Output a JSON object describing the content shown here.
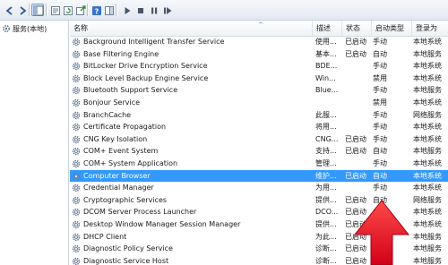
{
  "tree": {
    "root_label": "服务(本地)"
  },
  "columns": {
    "name": "名称",
    "desc": "描述",
    "status": "状态",
    "startup": "启动类型",
    "logon": "登录为"
  },
  "services": [
    {
      "name": "Background Intelligent Transfer Service",
      "desc": "使用...",
      "status": "已启动",
      "startup": "手动",
      "logon": "本地系统"
    },
    {
      "name": "Base Filtering Engine",
      "desc": "基本...",
      "status": "已启动",
      "startup": "自动",
      "logon": "本地服务"
    },
    {
      "name": "BitLocker Drive Encryption Service",
      "desc": "BDE...",
      "status": "",
      "startup": "手动",
      "logon": "本地系统"
    },
    {
      "name": "Block Level Backup Engine Service",
      "desc": "Win...",
      "status": "",
      "startup": "禁用",
      "logon": "本地系统"
    },
    {
      "name": "Bluetooth Support Service",
      "desc": "Blue...",
      "status": "",
      "startup": "手动",
      "logon": "本地服务"
    },
    {
      "name": "Bonjour Service",
      "desc": "",
      "status": "",
      "startup": "禁用",
      "logon": "本地系统"
    },
    {
      "name": "BranchCache",
      "desc": "此服...",
      "status": "",
      "startup": "手动",
      "logon": "网络服务"
    },
    {
      "name": "Certificate Propagation",
      "desc": "将用...",
      "status": "",
      "startup": "手动",
      "logon": "本地系统"
    },
    {
      "name": "CNG Key Isolation",
      "desc": "CNG...",
      "status": "已启动",
      "startup": "手动",
      "logon": "本地系统"
    },
    {
      "name": "COM+ Event System",
      "desc": "支持...",
      "status": "已启动",
      "startup": "自动",
      "logon": "本地服务"
    },
    {
      "name": "COM+ System Application",
      "desc": "管理...",
      "status": "",
      "startup": "手动",
      "logon": "本地系统"
    },
    {
      "name": "Computer Browser",
      "desc": "维护...",
      "status": "已启动",
      "startup": "自动",
      "logon": "本地系统"
    },
    {
      "name": "Credential Manager",
      "desc": "为用...",
      "status": "",
      "startup": "手动",
      "logon": "本地系统"
    },
    {
      "name": "Cryptographic Services",
      "desc": "提供...",
      "status": "已启动",
      "startup": "自动",
      "logon": "网络服务"
    },
    {
      "name": "DCOM Server Process Launcher",
      "desc": "DCO...",
      "status": "已启动",
      "startup": "自动",
      "logon": "本地系统"
    },
    {
      "name": "Desktop Window Manager Session Manager",
      "desc": "提供...",
      "status": "已启动",
      "startup": "自动",
      "logon": "本地系统"
    },
    {
      "name": "DHCP Client",
      "desc": "为此...",
      "status": "已启动",
      "startup": "自动",
      "logon": "本地服务"
    },
    {
      "name": "Diagnostic Policy Service",
      "desc": "诊断...",
      "status": "已启动",
      "startup": "自动",
      "logon": "本地服务"
    },
    {
      "name": "Diagnostic Service Host",
      "desc": "诊断...",
      "status": "已启动",
      "startup": "手动",
      "logon": "本地服务"
    }
  ],
  "selected_row": 11,
  "colors": {
    "selection": "#3399ff",
    "annotation_arrow": "#e0001b"
  },
  "icons": {
    "toolbar": [
      "back-icon",
      "forward-icon",
      "show-hide-tree-icon",
      "properties-icon",
      "refresh-icon",
      "export-list-icon",
      "help-icon",
      "action-pane-icon",
      "start-service-icon",
      "stop-service-icon",
      "pause-service-icon",
      "restart-service-icon"
    ],
    "service": "gear-icon"
  }
}
